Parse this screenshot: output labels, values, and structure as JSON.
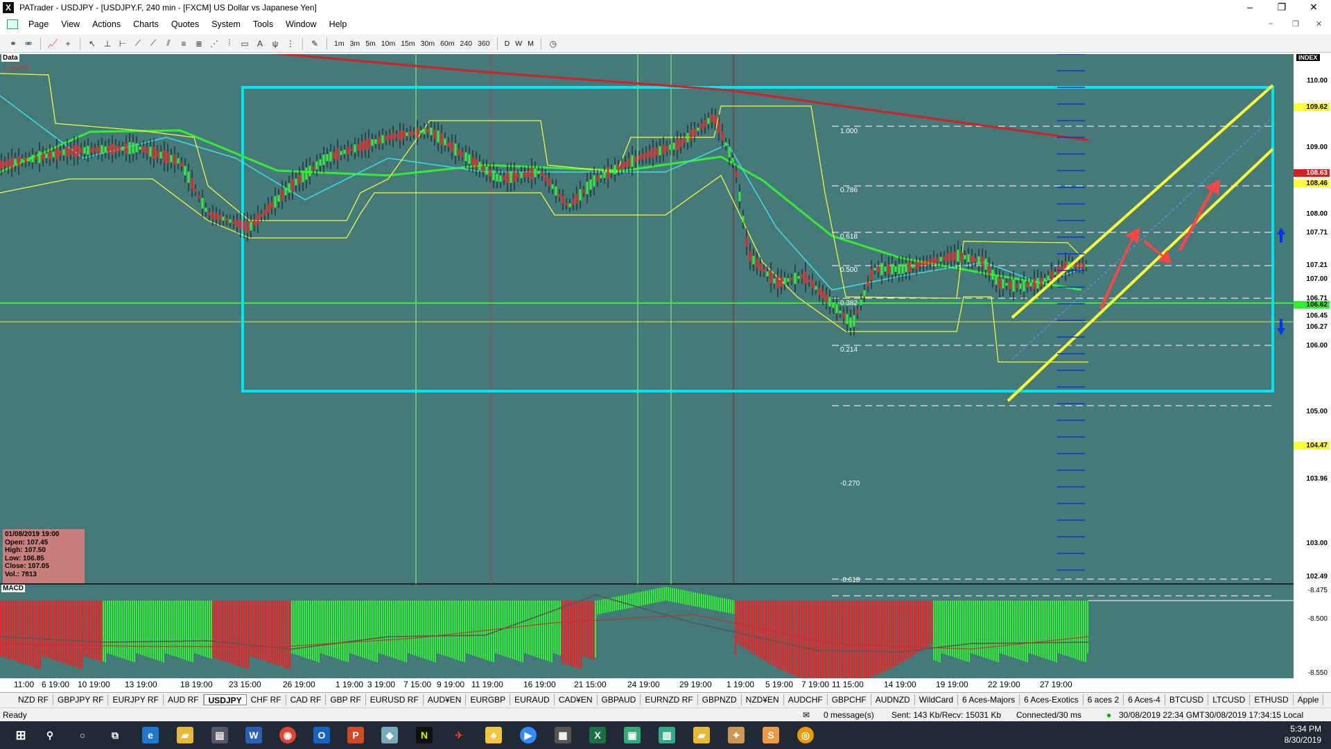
{
  "window": {
    "title": "PATrader - USDJPY - [USDJPY.F, 240 min - [FXCM] US Dollar vs Japanese Yen]",
    "minimize": "–",
    "restore": "❐",
    "close": "✕"
  },
  "menu": {
    "items": [
      "Page",
      "View",
      "Actions",
      "Charts",
      "Quotes",
      "System",
      "Tools",
      "Window",
      "Help"
    ]
  },
  "toolbar": {
    "timeframes": [
      "1m",
      "3m",
      "5m",
      "10m",
      "15m",
      "30m",
      "60m",
      "240",
      "360",
      "D",
      "W",
      "M"
    ]
  },
  "chart": {
    "data_label": "Data",
    "locked_label": "Locked",
    "index_label": "INDEX",
    "macd_label": "MACD",
    "colors": {
      "background": "#447a7a",
      "box": "#00e5ee",
      "channel": "#ffff33",
      "ma_red": "#d42020",
      "ma_green": "#33ee33",
      "arrow": "#ff4444"
    },
    "ohlc": {
      "date": "01/08/2019 19:00",
      "open": "Open: 107.45",
      "high": "High: 107.50",
      "low": "Low: 106.85",
      "close": "Close: 107.05",
      "vol": "Vol.: 7813"
    },
    "price_scale": [
      "110.00",
      "109.00",
      "108.00",
      "107.00",
      "105.00",
      "103.00"
    ],
    "price_tags": [
      {
        "text": "109.62",
        "bg": "#ffff33",
        "fg": "#000"
      },
      {
        "text": "108.63",
        "bg": "#d42020",
        "fg": "#fff"
      },
      {
        "text": "108.46",
        "bg": "#ffff33",
        "fg": "#000"
      },
      {
        "text": "107.71",
        "bg": "#ffffff",
        "fg": "#000"
      },
      {
        "text": "107.21",
        "bg": "#ffffff",
        "fg": "#000"
      },
      {
        "text": "106.71",
        "bg": "#ffffff",
        "fg": "#000"
      },
      {
        "text": "106.62",
        "bg": "#33ee33",
        "fg": "#000"
      },
      {
        "text": "106.45",
        "bg": "#ffffff",
        "fg": "#000"
      },
      {
        "text": "106.27",
        "bg": "#ffffff",
        "fg": "#000"
      },
      {
        "text": "106.00",
        "bg": "#ffffff",
        "fg": "#000"
      },
      {
        "text": "104.47",
        "bg": "#ffff33",
        "fg": "#000"
      },
      {
        "text": "103.96",
        "bg": "#ffffff",
        "fg": "#000"
      },
      {
        "text": "102.49",
        "bg": "#ffffff",
        "fg": "#000"
      }
    ],
    "fib_levels": [
      "1.000",
      "0.786",
      "0.618",
      "0.500",
      "0.382",
      "0.214",
      "-0.270",
      "-0.618"
    ],
    "macd_scale": [
      "-8.475",
      "-8.500",
      "-8.550"
    ],
    "time_labels": [
      "11:00",
      "6 19:00",
      "10 19:00",
      "13 19:00",
      "18 19:00",
      "23 15:00",
      "26 19:00",
      "1 19:00",
      "3 19:00",
      "7 15:00",
      "9 19:00",
      "11 19:00",
      "16 19:00",
      "21 15:00",
      "24 19:00",
      "29 19:00",
      "1 19:00",
      "5 19:00",
      "7 19:00",
      "11 15:00",
      "14 19:00",
      "19 19:00",
      "22 19:00",
      "27 19:00"
    ]
  },
  "symbol_tabs": [
    "NZD RF",
    "GBPJPY RF",
    "EURJPY RF",
    "AUD RF",
    "USDJPY",
    "CHF RF",
    "CAD RF",
    "GBP RF",
    "EURUSD RF",
    "AUD¥EN",
    "EURGBP",
    "EURAUD",
    "CAD¥EN",
    "GBPAUD",
    "EURNZD RF",
    "GBPNZD",
    "NZD¥EN",
    "AUDCHF",
    "GBPCHF",
    "AUDNZD",
    "WildCard",
    "6 Aces-Majors",
    "6 Aces-Exotics",
    "6 aces 2",
    "6 Aces-4",
    "BTCUSD",
    "LTCUSD",
    "ETHUSD",
    "Apple"
  ],
  "status": {
    "ready": "Ready",
    "messages": "0 message(s)",
    "sent": "Sent: 143 Kb/Recv: 15031 Kb",
    "connection": "Connected/30 ms",
    "gmt_time": "30/08/2019 22:34 GMT",
    "local_time": "30/08/2019 17:34:15 Local"
  },
  "taskbar": {
    "time": "5:34 PM",
    "date": "8/30/2019"
  }
}
